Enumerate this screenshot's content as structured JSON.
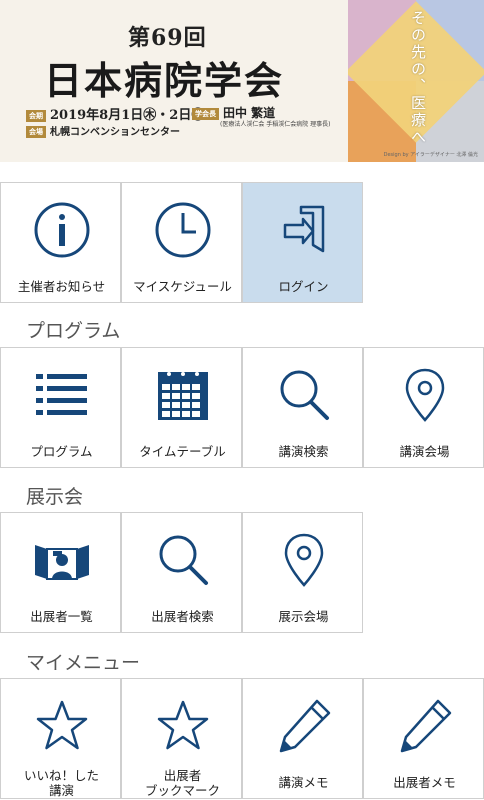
{
  "banner": {
    "subtitle": "第69回",
    "title": "日本病院学会",
    "date_tag": "会期",
    "date": "2019年8月1日㊍・2日㊎",
    "chair_tag": "学会長",
    "chair": "田中 繁道",
    "chair_org": "(医療法人渓仁会 手稲渓仁会病院 理事長)",
    "venue_tag": "会場",
    "venue": "札幌コンベンションセンター",
    "art_text": "その先の、医療へ",
    "credit": "Design by アイラーデザイナー 北澤 倫光"
  },
  "top_menu": [
    {
      "label": "主催者お知らせ",
      "icon": "info-icon"
    },
    {
      "label": "マイスケジュール",
      "icon": "clock-icon"
    },
    {
      "label": "ログイン",
      "icon": "login-icon"
    }
  ],
  "sections": {
    "program": "プログラム",
    "exhibit": "展示会",
    "mymenu": "マイメニュー"
  },
  "program_items": [
    {
      "label": "プログラム",
      "icon": "list-icon"
    },
    {
      "label": "タイムテーブル",
      "icon": "calendar-icon"
    },
    {
      "label": "講演検索",
      "icon": "search-icon"
    },
    {
      "label": "講演会場",
      "icon": "location-pin-icon"
    }
  ],
  "exhibit_items": [
    {
      "label": "出展者一覧",
      "icon": "exhibitor-booth-icon"
    },
    {
      "label": "出展者検索",
      "icon": "search-icon"
    },
    {
      "label": "展示会場",
      "icon": "location-pin-icon"
    }
  ],
  "mymenu_items": [
    {
      "label_line1": "いいね！した",
      "label_line2": "講演",
      "icon": "star-icon"
    },
    {
      "label_line1": "出展者",
      "label_line2": "ブックマーク",
      "icon": "star-icon"
    },
    {
      "label": "講演メモ",
      "icon": "pencil-icon"
    },
    {
      "label": "出展者メモ",
      "icon": "pencil-icon"
    }
  ],
  "colors": {
    "icon": "#16477a",
    "active_tile": "#c9dced",
    "gold_tag": "#b28a3c"
  }
}
